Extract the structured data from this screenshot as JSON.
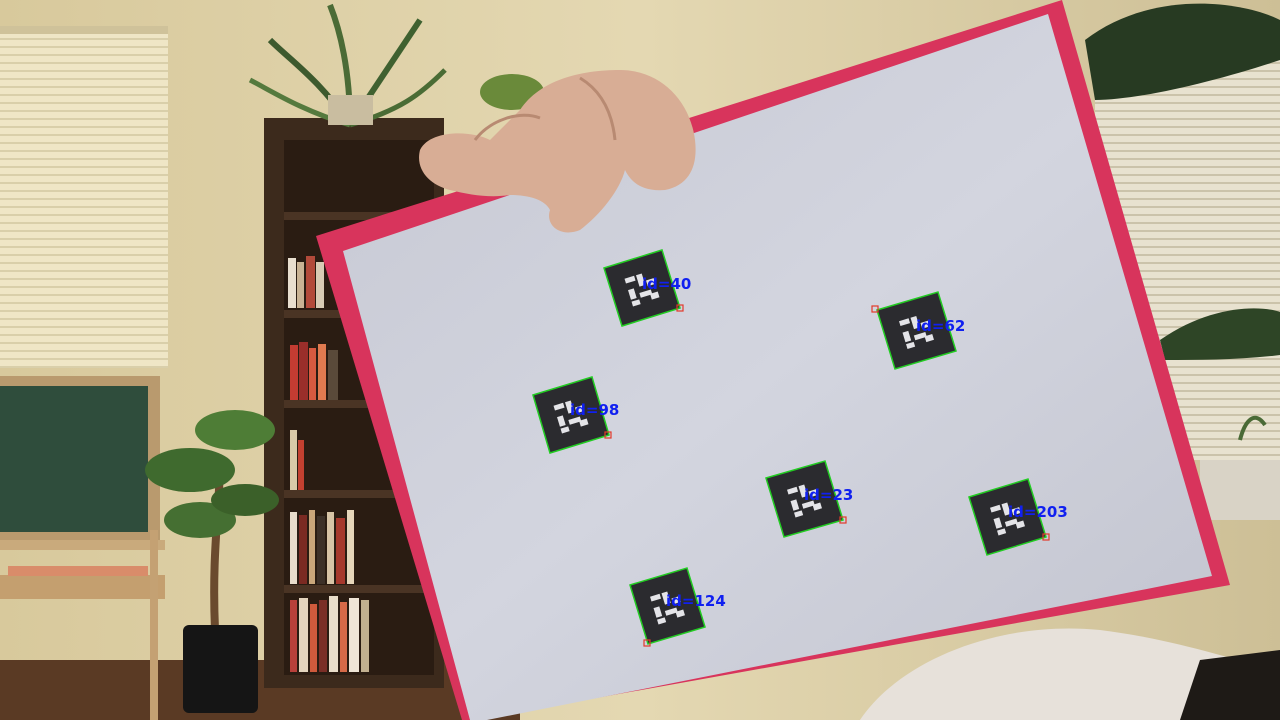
{
  "markers": [
    {
      "label": "id=40"
    },
    {
      "label": "id=62"
    },
    {
      "label": "id=98"
    },
    {
      "label": "id=23"
    },
    {
      "label": "id=203"
    },
    {
      "label": "id=124"
    }
  ],
  "colors": {
    "wall": "#d8c99c",
    "board_frame": "#d8345c",
    "board_surface": "#c9ccd6",
    "marker_outline": "#22cc22",
    "marker_corner": "#e23a2a",
    "label_text": "#1020f0"
  }
}
